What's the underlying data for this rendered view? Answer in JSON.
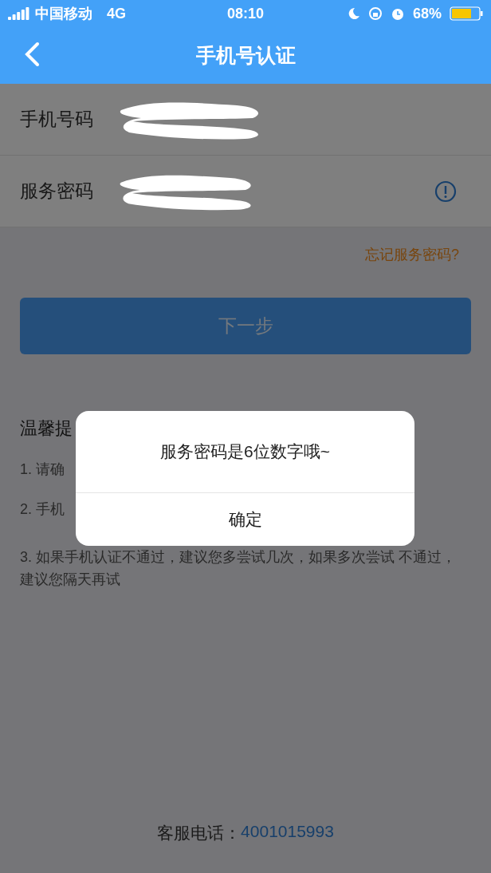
{
  "status_bar": {
    "carrier": "中国移动",
    "network": "4G",
    "time": "08:10",
    "battery": "68%"
  },
  "nav": {
    "title": "手机号认证"
  },
  "form": {
    "fields": [
      {
        "label": "手机号码",
        "redacted": true,
        "info_icon": false
      },
      {
        "label": "服务密码",
        "redacted": true,
        "info_icon": true
      }
    ]
  },
  "forgot_link": "忘记服务密码?",
  "next_button": "下一步",
  "tips": {
    "heading": "温馨提",
    "items": [
      "1. 请确",
      "2. 手机",
      "3. 如果手机认证不通过，建议您多尝试几次，如果多次尝试 不通过，建议您隔天再试"
    ]
  },
  "hotline": {
    "label": "客服电话：",
    "number": "4001015993"
  },
  "dialog": {
    "open": true,
    "message": "服务密码是6位数字哦~",
    "button": "确定"
  }
}
